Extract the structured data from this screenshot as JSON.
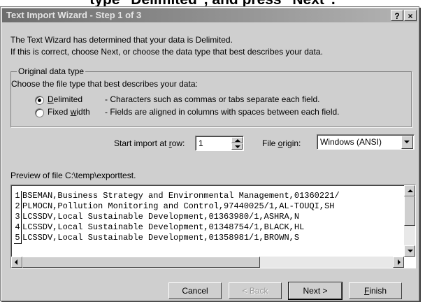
{
  "caption": {
    "text": "type \"Delimited\", and press \"Next\"."
  },
  "window": {
    "title": "Text Import Wizard - Step 1 of 3",
    "help_label": "?",
    "close_label": "×"
  },
  "intro": {
    "line1": "The Text Wizard has determined that your data is Delimited.",
    "line2": "If this is correct, choose Next, or choose the data type that best describes your data."
  },
  "data_type": {
    "group_label": "Original data type",
    "prompt": "Choose the file type that best describes your data:",
    "options": [
      {
        "label": "Delimited",
        "description": "- Characters such as commas or tabs separate each field.",
        "selected": true
      },
      {
        "label": "Fixed width",
        "description": "- Fields are aligned in columns with spaces between each field.",
        "selected": false
      }
    ]
  },
  "import_settings": {
    "start_row_label": "Start import at row:",
    "start_row_value": "1",
    "file_origin_label": "File origin:",
    "file_origin_value": "Windows (ANSI)"
  },
  "preview": {
    "label": "Preview of file C:\\temp\\exporttest.",
    "rows": [
      {
        "num": "1",
        "text": "BSEMAN,Business Strategy and Environmental Management,01360221/"
      },
      {
        "num": "2",
        "text": "PLMOCN,Pollution Monitoring and Control,97440025/1,AL-TOUQI,SH"
      },
      {
        "num": "3",
        "text": "LCSSDV,Local Sustainable Development,01363980/1,ASHRA,N"
      },
      {
        "num": "4",
        "text": "LCSSDV,Local Sustainable Development,01348754/1,BLACK,HL"
      },
      {
        "num": "5",
        "text": "LCSSDV,Local Sustainable Development,01358981/1,BROWN,S"
      }
    ]
  },
  "buttons": {
    "cancel": "Cancel",
    "back": "< Back",
    "next": "Next >",
    "finish": "Finish"
  },
  "colors": {
    "dialog_face": "#cfcfcf",
    "title_gradient_start": "#6d6d6d",
    "title_gradient_end": "#b4b4b4"
  }
}
